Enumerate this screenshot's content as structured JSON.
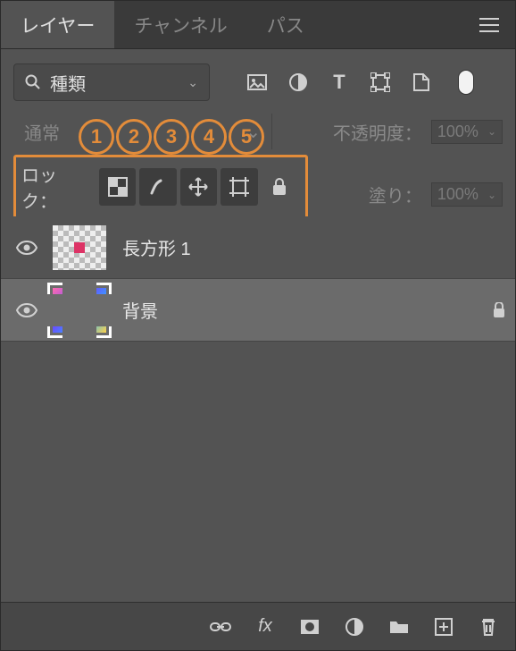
{
  "tabs": {
    "layers": "レイヤー",
    "channels": "チャンネル",
    "paths": "パス"
  },
  "filter": {
    "type_label": "種類"
  },
  "blend": {
    "mode": "通常"
  },
  "opacity": {
    "label": "不透明度：",
    "value": "100%"
  },
  "fill": {
    "label": "塗り：",
    "value": "100%"
  },
  "lock": {
    "label": "ロック："
  },
  "numbers": [
    "1",
    "2",
    "3",
    "4",
    "5"
  ],
  "layers": {
    "items": [
      {
        "name": "長方形 1",
        "locked": false
      },
      {
        "name": "背景",
        "locked": true
      }
    ]
  }
}
